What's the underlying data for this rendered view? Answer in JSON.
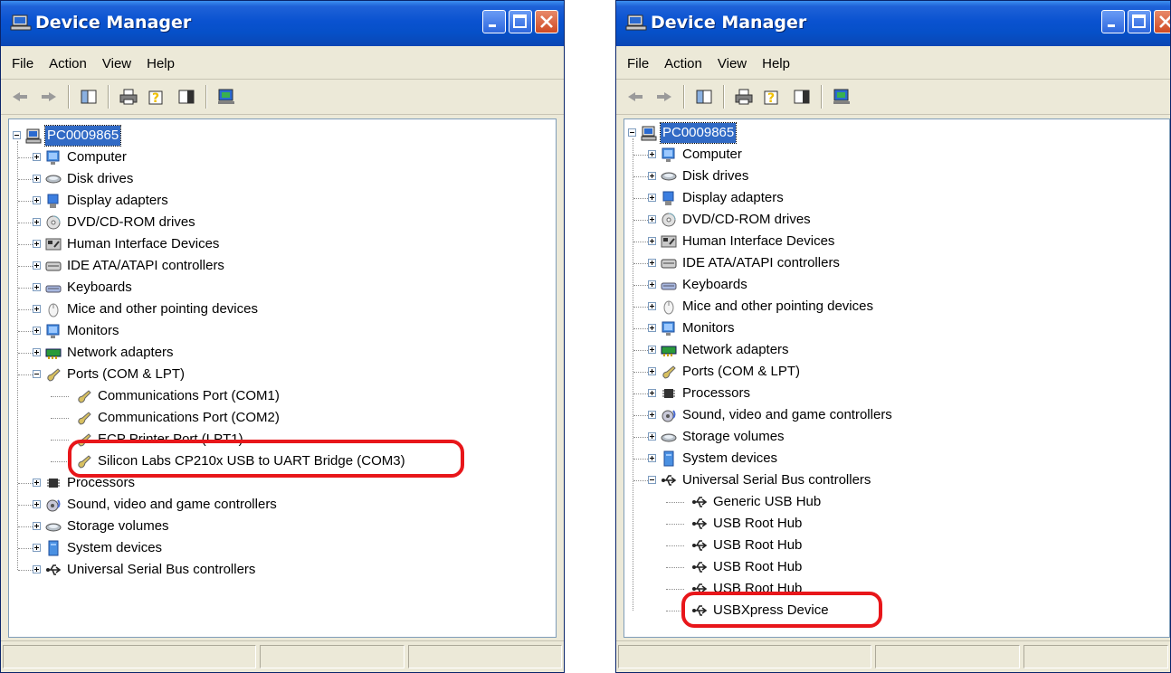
{
  "colors": {
    "titlebar": "#0a52d0",
    "selection": "#316ac5",
    "highlight": "#e8161a"
  },
  "left_window": {
    "title": "Device Manager",
    "menu": [
      "File",
      "Action",
      "View",
      "Help"
    ],
    "tree": {
      "root": "PC0009865",
      "items": [
        "Computer",
        "Disk drives",
        "Display adapters",
        "DVD/CD-ROM drives",
        "Human Interface Devices",
        "IDE ATA/ATAPI controllers",
        "Keyboards",
        "Mice and other pointing devices",
        "Monitors",
        "Network adapters",
        "Ports (COM & LPT)",
        "Communications Port (COM1)",
        "Communications Port (COM2)",
        "ECP Printer Port (LPT1)",
        "Silicon Labs CP210x USB to UART Bridge (COM3)",
        "Processors",
        "Sound, video and game controllers",
        "Storage volumes",
        "System devices",
        "Universal Serial Bus controllers"
      ]
    }
  },
  "right_window": {
    "title": "Device Manager",
    "menu": [
      "File",
      "Action",
      "View",
      "Help"
    ],
    "tree": {
      "root": "PC0009865",
      "items": [
        "Computer",
        "Disk drives",
        "Display adapters",
        "DVD/CD-ROM drives",
        "Human Interface Devices",
        "IDE ATA/ATAPI controllers",
        "Keyboards",
        "Mice and other pointing devices",
        "Monitors",
        "Network adapters",
        "Ports (COM & LPT)",
        "Processors",
        "Sound, video and game controllers",
        "Storage volumes",
        "System devices",
        "Universal Serial Bus controllers",
        "Generic USB Hub",
        "USB Root Hub",
        "USB Root Hub",
        "USB Root Hub",
        "USB Root Hub",
        "USBXpress Device"
      ]
    }
  }
}
